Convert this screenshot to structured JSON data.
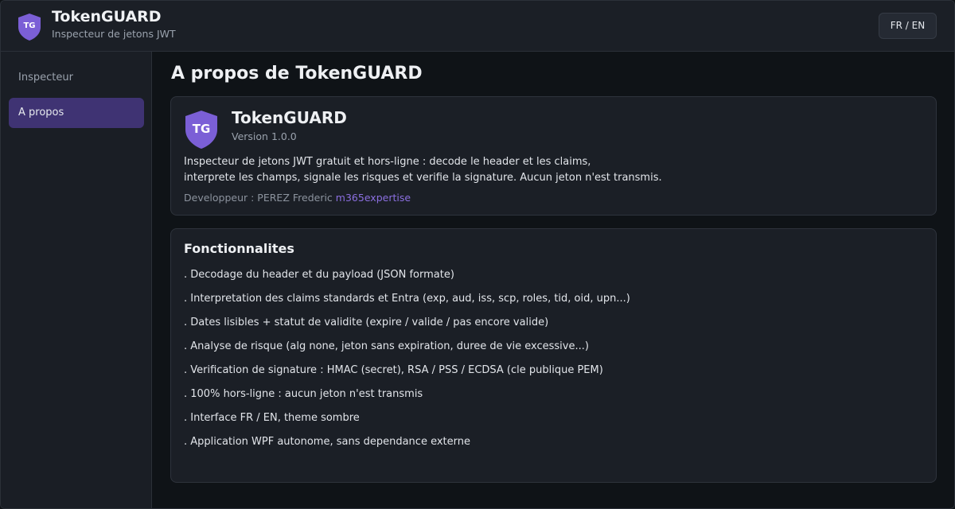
{
  "app": {
    "logo_text": "TG",
    "title": "TokenGUARD",
    "subtitle": "Inspecteur de jetons JWT",
    "lang_toggle": "FR / EN"
  },
  "sidebar": {
    "items": [
      {
        "label": "Inspecteur",
        "active": false
      },
      {
        "label": "A propos",
        "active": true
      }
    ]
  },
  "main": {
    "page_title": "A propos de TokenGUARD",
    "about": {
      "logo_text": "TG",
      "name": "TokenGUARD",
      "version": "Version 1.0.0",
      "desc_line1": "Inspecteur de jetons JWT gratuit et hors-ligne : decode le header et les claims,",
      "desc_line2": "interprete les champs, signale les risques et verifie la signature. Aucun jeton n'est transmis.",
      "developer_label": "Developpeur : PEREZ Frederic",
      "developer_link": "m365expertise"
    },
    "features": {
      "title": "Fonctionnalites",
      "items": [
        ". Decodage du header et du payload (JSON formate)",
        ". Interpretation des claims standards et Entra (exp, aud, iss, scp, roles, tid, oid, upn...)",
        ". Dates lisibles + statut de validite (expire / valide / pas encore valide)",
        ". Analyse de risque (alg none, jeton sans expiration, duree de vie excessive...)",
        ". Verification de signature : HMAC (secret), RSA / PSS / ECDSA (cle publique PEM)",
        ". 100% hors-ligne : aucun jeton n'est transmis",
        ". Interface FR / EN, theme sombre",
        ". Application WPF autonome, sans dependance externe"
      ]
    }
  },
  "colors": {
    "accent": "#7b5fd6",
    "nav_active_bg": "#3f3373",
    "link": "#8b6fe0"
  },
  "icons": {
    "logo": "shield-icon"
  }
}
